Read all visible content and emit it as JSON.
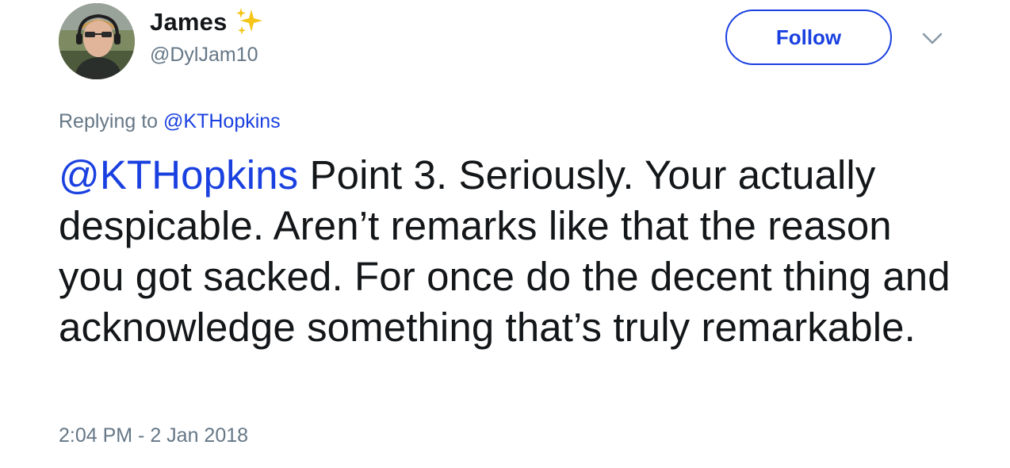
{
  "author": {
    "display_name": "James",
    "handle": "@DylJam10",
    "badge_icon": "sparkles-icon"
  },
  "follow_button": {
    "label": "Follow"
  },
  "menu": {
    "icon": "chevron-down-icon"
  },
  "reply": {
    "prefix": "Replying to",
    "to": "@KTHopkins"
  },
  "tweet": {
    "mention": "@KTHopkins",
    "body": "Point 3. Seriously. Your actually despicable. Aren’t remarks like that the reason you got sacked. For once do the decent thing and acknowledge something that’s truly remarkable."
  },
  "timestamp": "2:04 PM - 2 Jan 2018",
  "colors": {
    "link": "#1a40e0",
    "text": "#14171a",
    "muted": "#657786",
    "sparkle": "#f5c518"
  }
}
